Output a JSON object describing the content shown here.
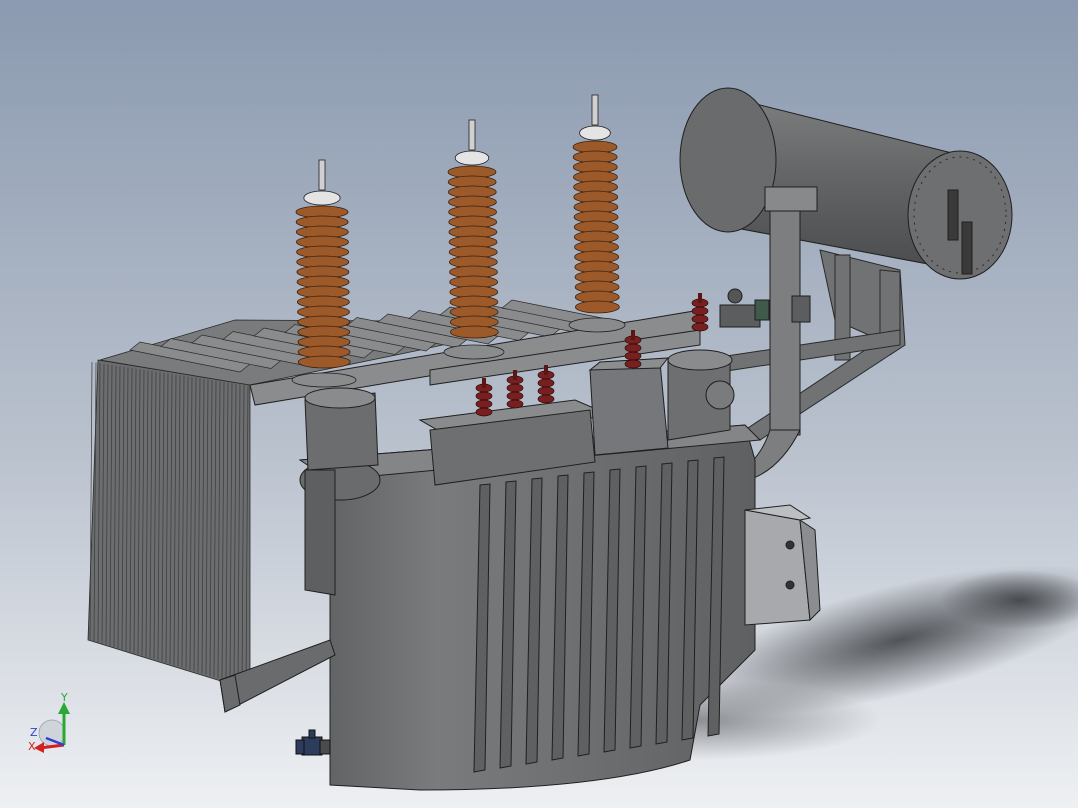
{
  "viewport": {
    "background_top": "#8b9ab0",
    "background_bottom": "#eef0f3",
    "model_color": "#6f7072",
    "model_dark": "#4e4f51",
    "model_light": "#8a8b8d",
    "insulator_color": "#9c5a2a",
    "red_bushing_color": "#7a1f1f",
    "valve_color": "#2d3b5c"
  },
  "triad": {
    "y_label": "Y",
    "z_label": "Z",
    "x_label": "X",
    "y_color": "#2aa836",
    "z_color": "#2f3fd0",
    "x_color": "#d42020"
  }
}
